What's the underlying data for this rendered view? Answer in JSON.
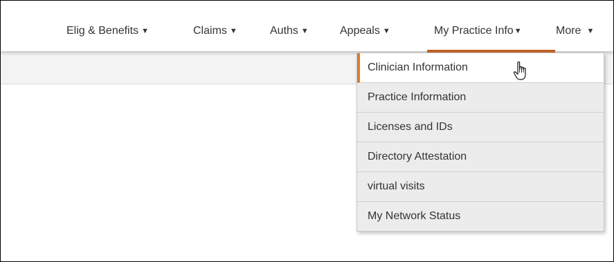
{
  "nav": {
    "items": [
      {
        "label": "Elig & Benefits",
        "caret": "▼"
      },
      {
        "label": "Claims",
        "caret": "▼"
      },
      {
        "label": "Auths",
        "caret": "▼"
      },
      {
        "label": "Appeals",
        "caret": "▼"
      },
      {
        "label": "My Practice Info",
        "caret": "▼"
      },
      {
        "label": "More",
        "caret": "▼"
      }
    ],
    "active_item": "My Practice Info",
    "accent_color": "#c0602a"
  },
  "dropdown": {
    "items": [
      {
        "label": "Clinician Information"
      },
      {
        "label": "Practice Information"
      },
      {
        "label": "Licenses and IDs"
      },
      {
        "label": "Directory Attestation"
      },
      {
        "label": "virtual visits"
      },
      {
        "label": "My Network Status"
      }
    ],
    "hovered_item": "Clinician Information",
    "hover_accent_color": "#e07a2b"
  },
  "cursor": {
    "icon": "hand-pointer-icon"
  }
}
